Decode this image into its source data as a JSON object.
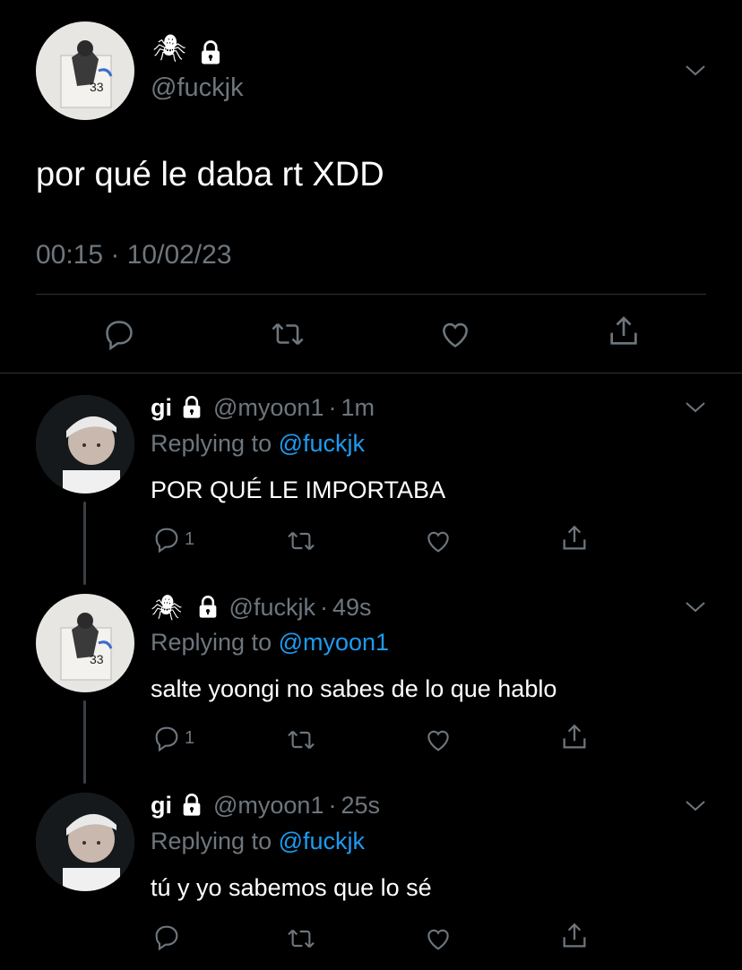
{
  "main_tweet": {
    "display_name_emoji": "🕷",
    "handle": "@fuckjk",
    "text": "por qué le daba rt XDD",
    "timestamp": "00:15 · 10/02/23"
  },
  "replies": [
    {
      "display_name": "gi",
      "handle": "@myoon1",
      "time": "1m",
      "replying_prefix": "Replying to",
      "replying_to": "@fuckjk",
      "text": "POR QUÉ LE IMPORTABA",
      "reply_count": "1"
    },
    {
      "display_name_emoji": "🕷",
      "handle": "@fuckjk",
      "time": "49s",
      "replying_prefix": "Replying to",
      "replying_to": "@myoon1",
      "text": "salte yoongi no sabes de lo que hablo",
      "reply_count": "1"
    },
    {
      "display_name": "gi",
      "handle": "@myoon1",
      "time": "25s",
      "replying_prefix": "Replying to",
      "replying_to": "@fuckjk",
      "text": "tú y yo sabemos que lo sé",
      "reply_count": ""
    }
  ],
  "colors": {
    "background": "#000000",
    "muted": "#6e767d",
    "link": "#1d9bf0",
    "divider": "#2f3336"
  },
  "icons": [
    "lock-icon",
    "chevron-down-icon",
    "reply-icon",
    "retweet-icon",
    "like-icon",
    "share-icon",
    "spider-icon"
  ]
}
